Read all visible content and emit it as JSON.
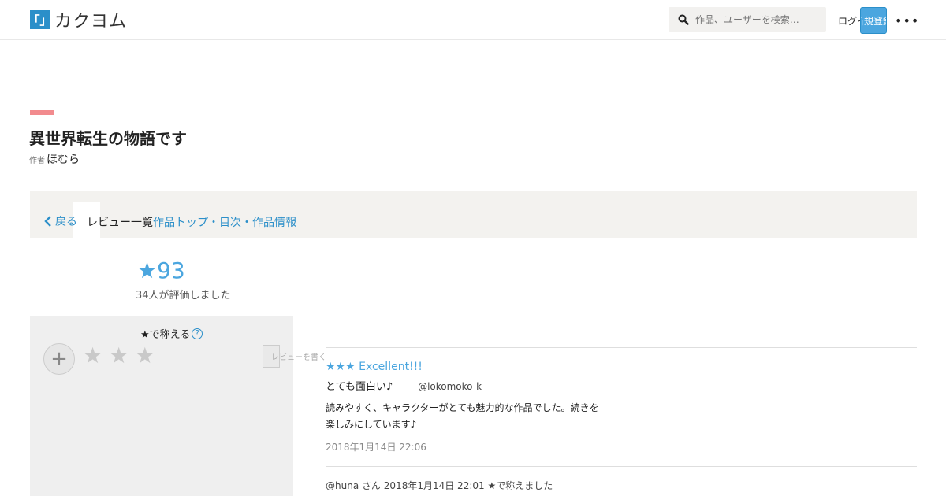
{
  "header": {
    "logo_mark": "「」",
    "logo_text": "カクヨム",
    "search_placeholder": "作品、ユーザーを検索…",
    "login_label": "ログイン",
    "register_label": "新規登録",
    "more_icon": "•••"
  },
  "work": {
    "title": "異世界転生の物語です",
    "author_prefix": "作者",
    "author_name": "ほむら"
  },
  "tabs": {
    "back_label": "戻る",
    "current_label": "レビュー一覧",
    "links": "作品トップ・目次・作品情報"
  },
  "score": {
    "value": "★93",
    "subtext": "34人が評価しました"
  },
  "rate_panel": {
    "title": "★で称える",
    "help_icon": "?",
    "plus_icon": "+",
    "stars": "★★★",
    "submit_label": "レビューを書く"
  },
  "reviews": [
    {
      "stars": "★★★ Excellent!!!",
      "title": "とても面白い♪",
      "author": "—— @lokomoko-k",
      "body_line1": "読みやすく、キャラクターがとても魅力的な作品でした。続きを",
      "body_line2": "楽しみにしています♪",
      "date": "2018年1月14日 22:06"
    }
  ],
  "review_meta": "@huna さん 2018年1月14日 22:01 ★で称えました"
}
